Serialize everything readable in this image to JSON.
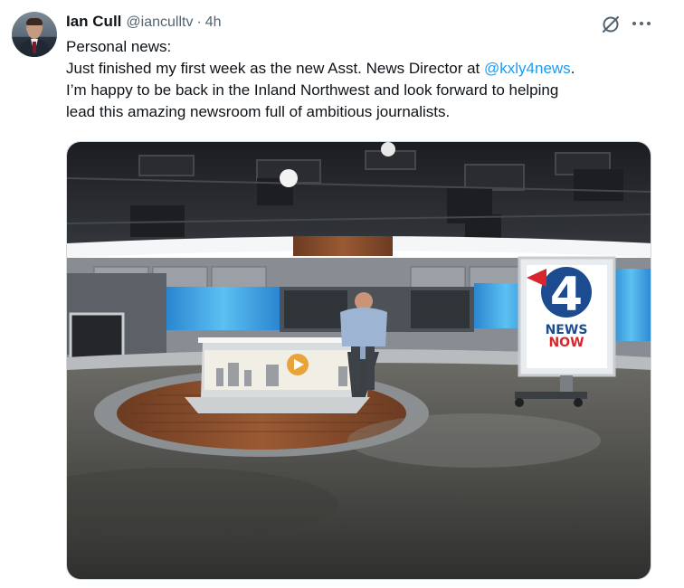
{
  "author": {
    "display_name": "Ian Cull",
    "handle": "@ianculltv",
    "separator": "·",
    "time": "4h"
  },
  "post": {
    "line1": "Personal news:",
    "line2_prefix": "Just finished my first week as the new Asst. News Director at ",
    "mention": "@kxly4news",
    "line2_suffix": ".",
    "line3": "I’m happy to be back in the Inland Northwest and look forward to helping",
    "line4": "lead this amazing newsroom full of ambitious journalists."
  },
  "media": {
    "sign_text_top": "NEWS",
    "sign_text_bottom": "NOW",
    "sign_number": "4",
    "colors": {
      "brand_red": "#d7262e",
      "brand_blue": "#1c4b8f",
      "screen_blue": "#3aa7e6"
    }
  },
  "icons": [
    "avatar",
    "grok-icon",
    "more-icon"
  ],
  "colors": {
    "link": "#1d9bf0",
    "secondary_text": "#536471",
    "primary_text": "#0f1419"
  }
}
